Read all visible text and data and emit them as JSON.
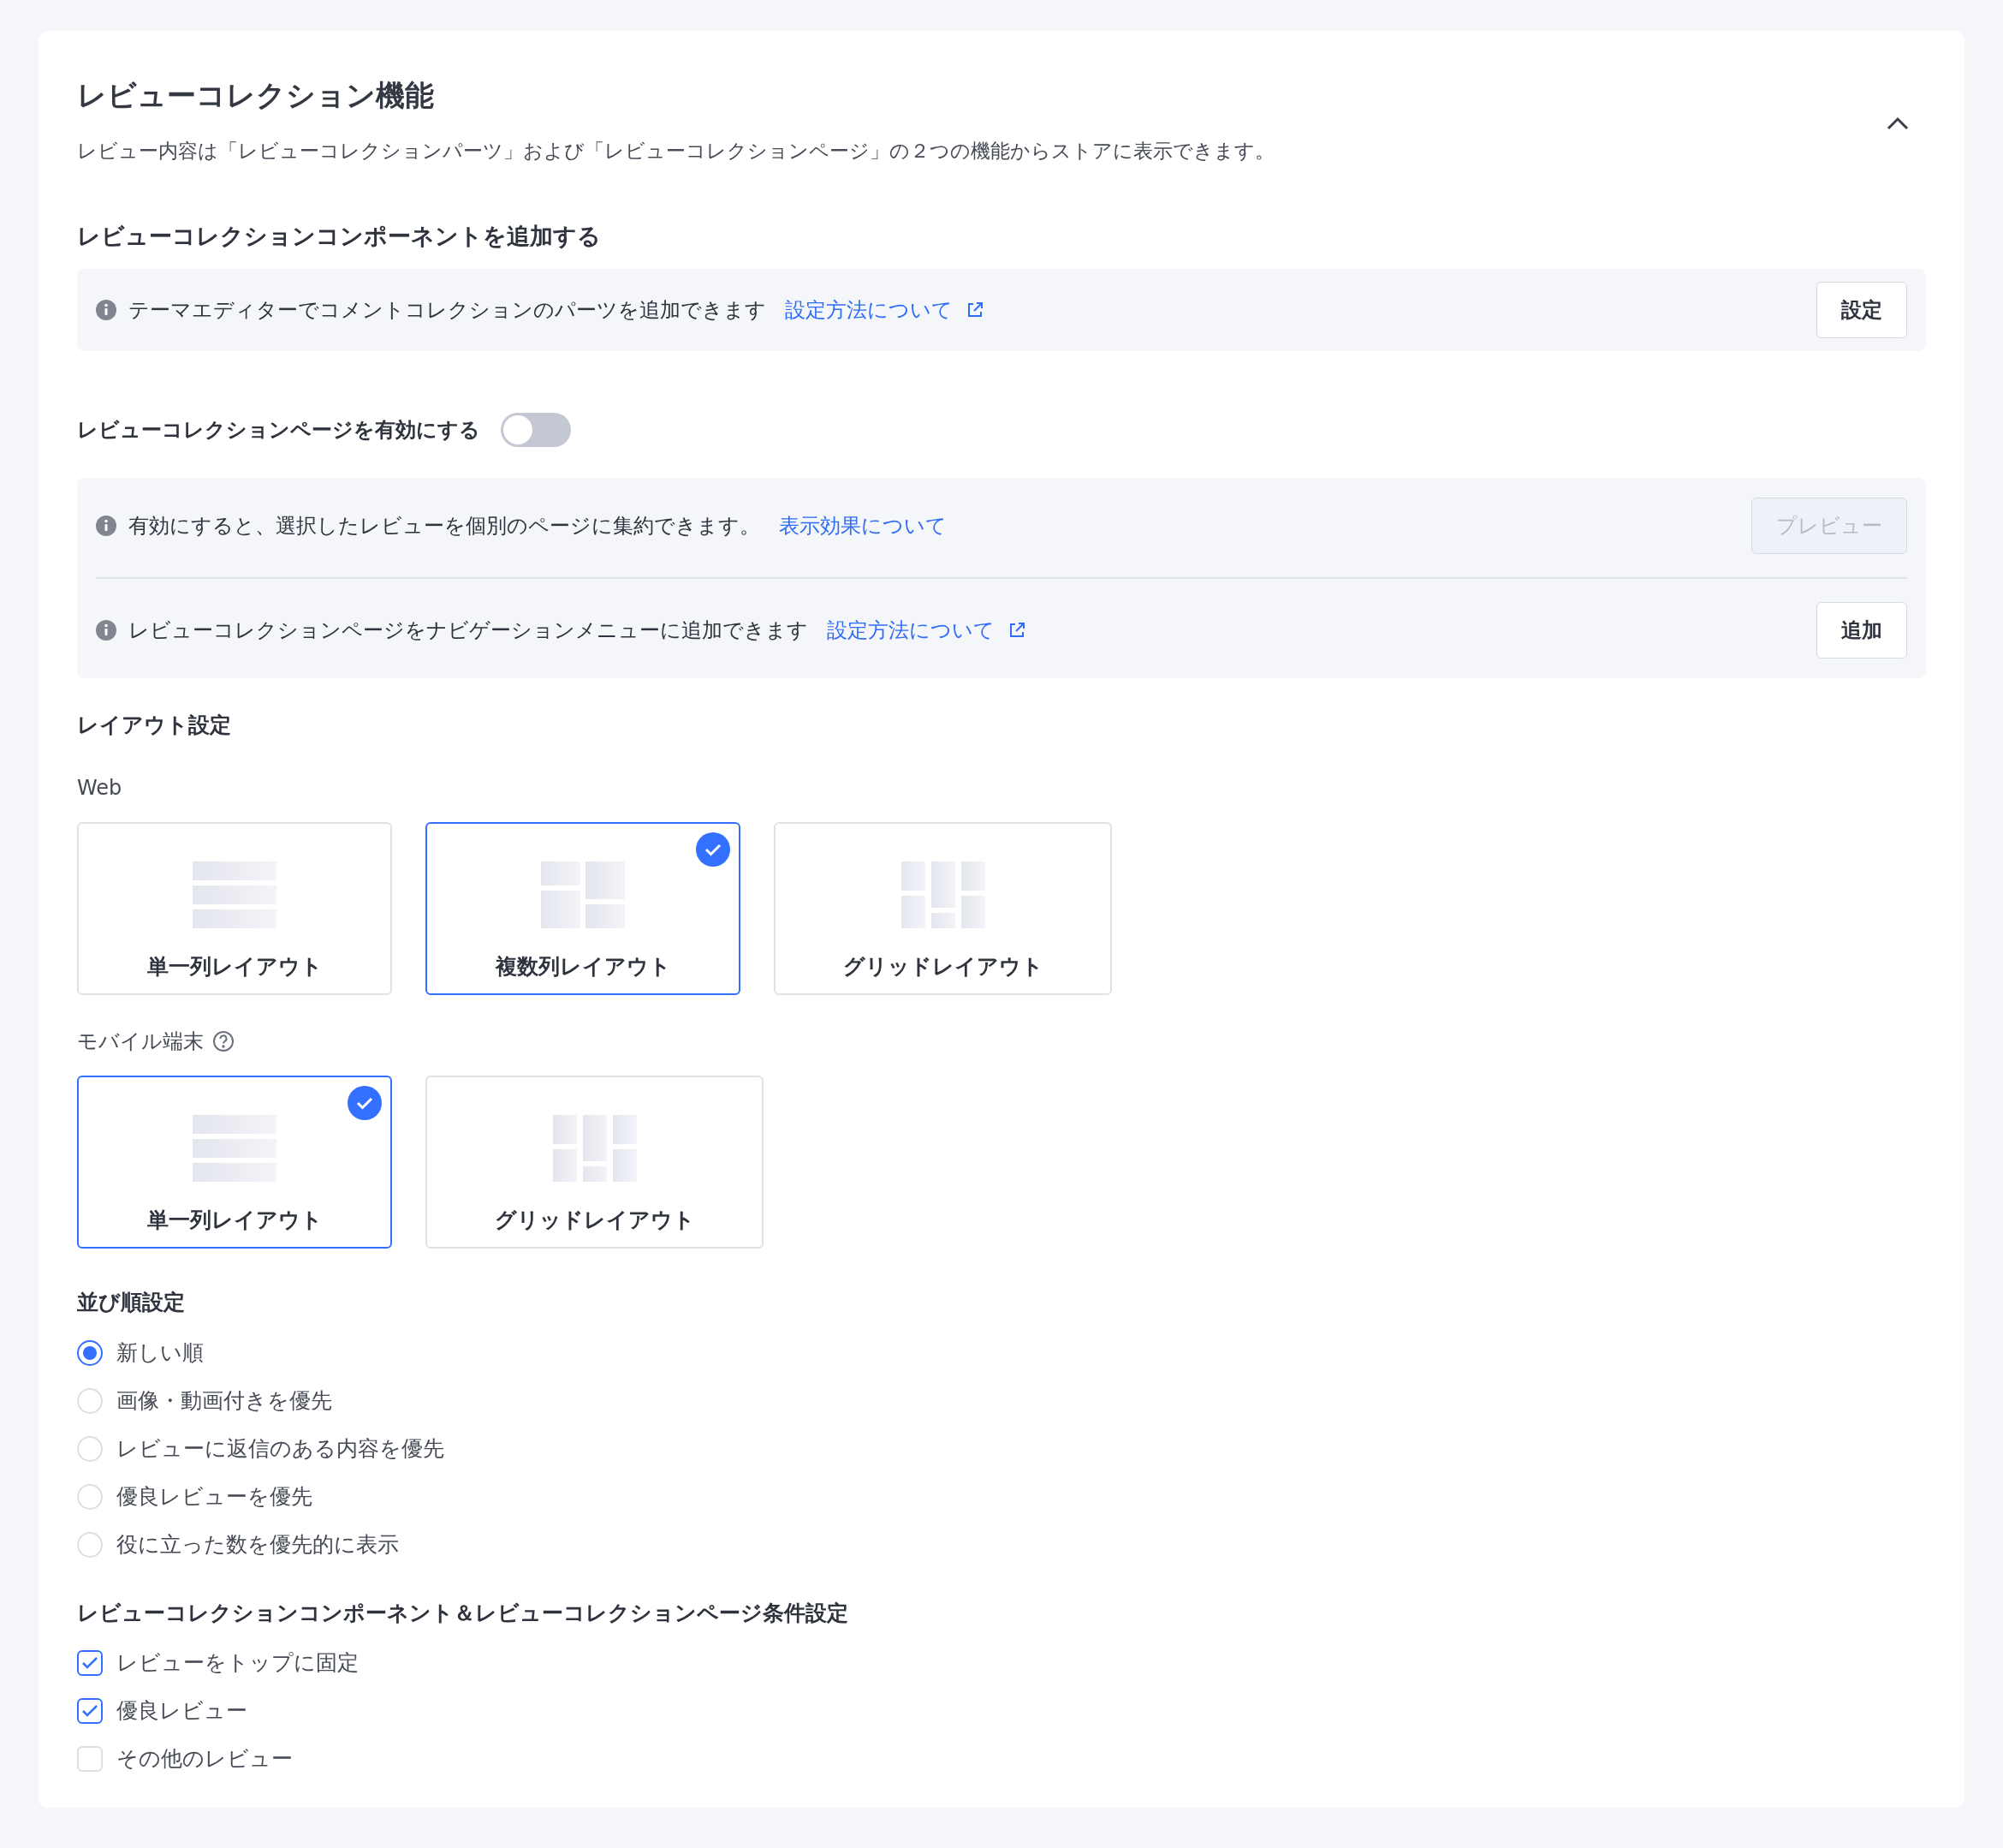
{
  "section": {
    "title": "レビューコレクション機能",
    "description": "レビュー内容は「レビューコレクションパーツ」および「レビューコレクションページ」の２つの機能からストアに表示できます。",
    "expanded": true
  },
  "component": {
    "heading": "レビューコレクションコンポーネントを追加する",
    "rows": [
      {
        "text": "テーマエディターでコメントコレクションのパーツを追加できます",
        "link": "設定方法について",
        "external": true,
        "button": "設定",
        "disabled": false
      }
    ]
  },
  "page_toggle": {
    "label": "レビューコレクションページを有効にする",
    "on": false
  },
  "page_info": {
    "rows": [
      {
        "text": "有効にすると、選択したレビューを個別のページに集約できます。",
        "link": "表示効果について",
        "external": false,
        "button": "プレビュー",
        "disabled": true
      },
      {
        "text": "レビューコレクションページをナビゲーションメニューに追加できます",
        "link": "設定方法について",
        "external": true,
        "button": "追加",
        "disabled": false
      }
    ]
  },
  "layout": {
    "heading": "レイアウト設定",
    "groups": [
      {
        "label": "Web",
        "help": false,
        "options": [
          {
            "label": "単一列レイアウト",
            "kind": "single",
            "selected": false
          },
          {
            "label": "複数列レイアウト",
            "kind": "multi",
            "selected": true
          },
          {
            "label": "グリッドレイアウト",
            "kind": "grid",
            "selected": false
          }
        ]
      },
      {
        "label": "モバイル端末",
        "help": true,
        "options": [
          {
            "label": "単一列レイアウト",
            "kind": "single",
            "selected": true
          },
          {
            "label": "グリッドレイアウト",
            "kind": "grid",
            "selected": false
          }
        ]
      }
    ]
  },
  "sort": {
    "heading": "並び順設定",
    "options": [
      {
        "label": "新しい順",
        "selected": true
      },
      {
        "label": "画像・動画付きを優先",
        "selected": false
      },
      {
        "label": "レビューに返信のある内容を優先",
        "selected": false
      },
      {
        "label": "優良レビューを優先",
        "selected": false
      },
      {
        "label": "役に立った数を優先的に表示",
        "selected": false
      }
    ]
  },
  "conditions": {
    "heading": "レビューコレクションコンポーネント＆レビューコレクションページ条件設定",
    "options": [
      {
        "label": "レビューをトップに固定",
        "checked": true
      },
      {
        "label": "優良レビュー",
        "checked": true
      },
      {
        "label": "その他のレビュー",
        "checked": false
      }
    ]
  }
}
